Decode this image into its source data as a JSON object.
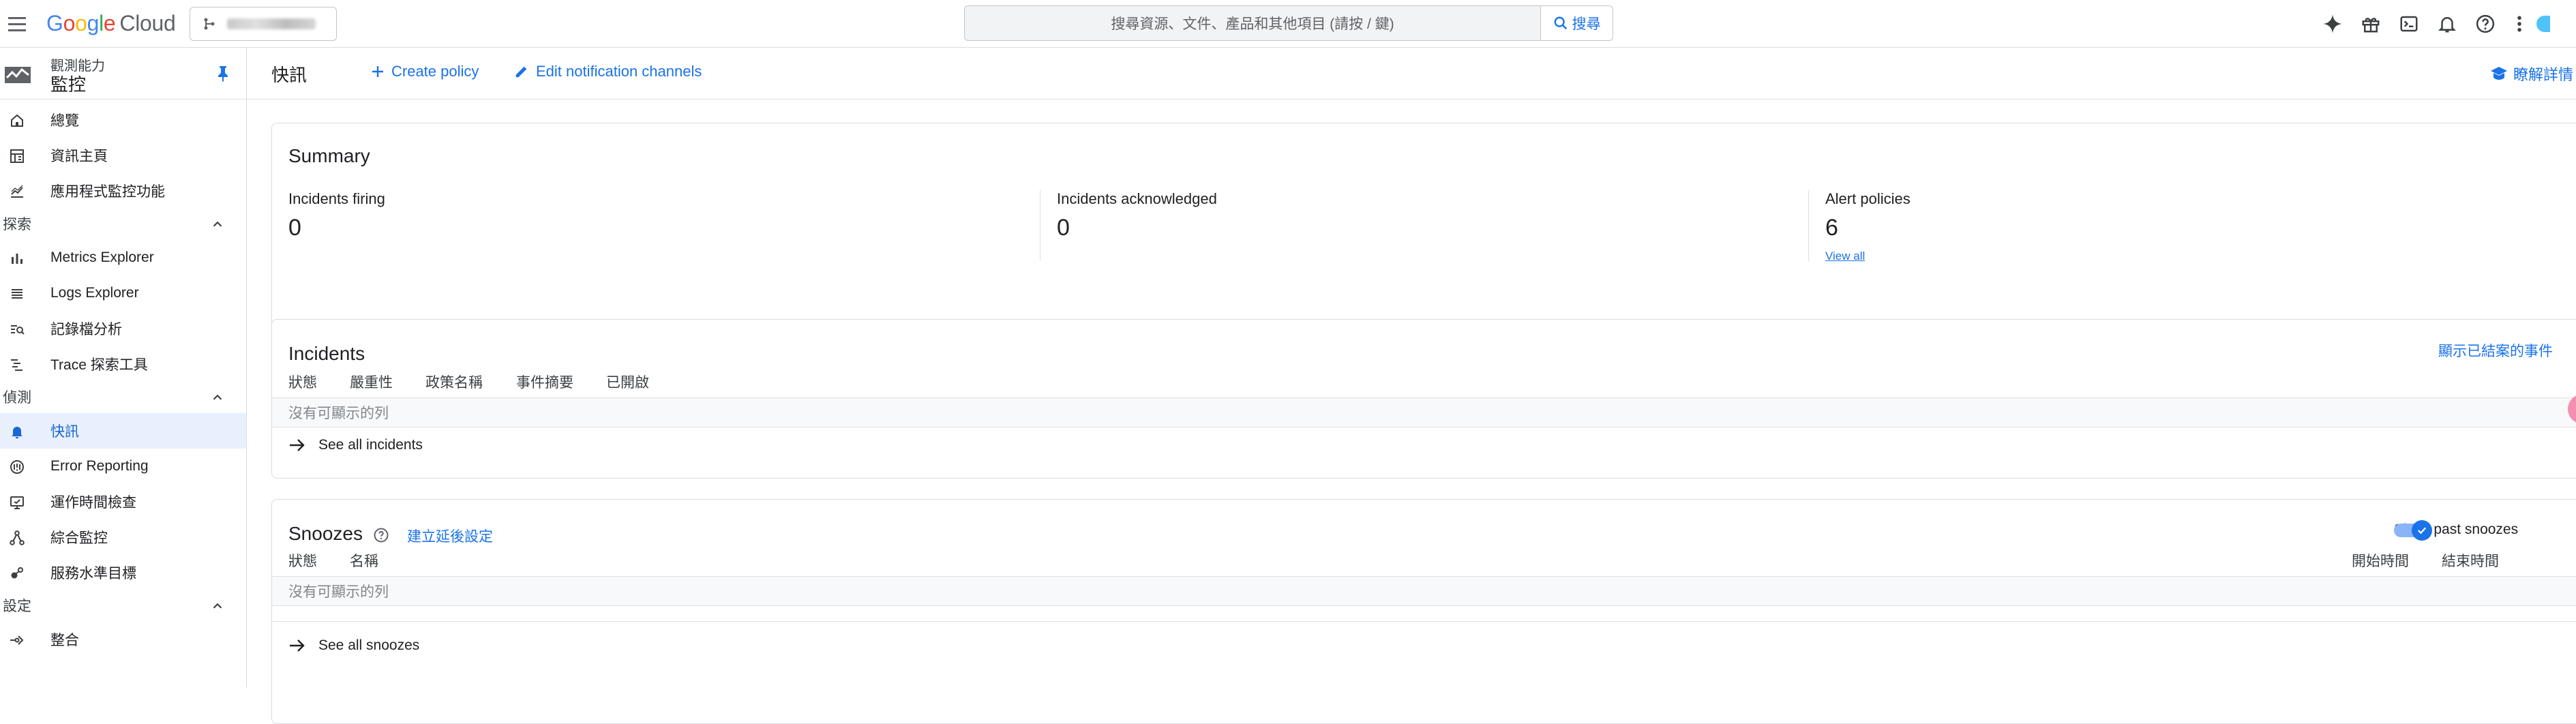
{
  "topbar": {
    "logo_letters": [
      "G",
      "o",
      "o",
      "g",
      "l",
      "e"
    ],
    "logo_cloud": "Cloud",
    "search_placeholder": "搜尋資源、文件、產品和其他項目 (請按 / 鍵)",
    "search_button": "搜尋",
    "icons": [
      "gemini-icon",
      "gift-icon",
      "cloud-shell-icon",
      "notifications-icon",
      "help-icon",
      "more-vert-icon"
    ]
  },
  "sidebar": {
    "product_category": "觀測能力",
    "product_name": "監控",
    "items_top": [
      {
        "label": "總覽",
        "icon": "home-icon"
      },
      {
        "label": "資訊主頁",
        "icon": "dashboard-icon"
      },
      {
        "label": "應用程式監控功能",
        "icon": "app-monitoring-icon"
      }
    ],
    "section_explore": "探索",
    "items_explore": [
      {
        "label": "Metrics Explorer",
        "icon": "bar-chart-icon"
      },
      {
        "label": "Logs Explorer",
        "icon": "list-icon"
      },
      {
        "label": "記錄檔分析",
        "icon": "log-analytics-icon"
      },
      {
        "label": "Trace 探索工具",
        "icon": "trace-icon"
      }
    ],
    "section_detect": "偵測",
    "items_detect": [
      {
        "label": "快訊",
        "icon": "bell-icon",
        "active": true
      },
      {
        "label": "Error Reporting",
        "icon": "error-reporting-icon"
      },
      {
        "label": "運作時間檢查",
        "icon": "uptime-icon"
      },
      {
        "label": "綜合監控",
        "icon": "synthetic-icon"
      },
      {
        "label": "服務水準目標",
        "icon": "slo-icon"
      }
    ],
    "section_config": "設定",
    "items_config": [
      {
        "label": "整合",
        "icon": "integrations-icon"
      }
    ]
  },
  "toolbar": {
    "title": "快訊",
    "create_policy": "Create policy",
    "edit_channels": "Edit notification channels",
    "learn_more": "瞭解詳情"
  },
  "summary": {
    "title": "Summary",
    "firing_label": "Incidents firing",
    "firing_value": "0",
    "ack_label": "Incidents acknowledged",
    "ack_value": "0",
    "policies_label": "Alert policies",
    "policies_value": "6",
    "view_all": "View all"
  },
  "incidents": {
    "title": "Incidents",
    "show_closed": "顯示已結案的事件",
    "columns": [
      "狀態",
      "嚴重性",
      "政策名稱",
      "事件摘要",
      "已開啟"
    ],
    "empty": "沒有可顯示的列",
    "see_all": "See all incidents"
  },
  "snoozes": {
    "title": "Snoozes",
    "create_link": "建立延後設定",
    "show_past": "Show past snoozes",
    "show_past_checked": true,
    "columns_left": [
      "狀態",
      "名稱"
    ],
    "columns_right": [
      "開始時間",
      "結束時間"
    ],
    "empty": "沒有可顯示的列",
    "see_all": "See all snoozes"
  }
}
